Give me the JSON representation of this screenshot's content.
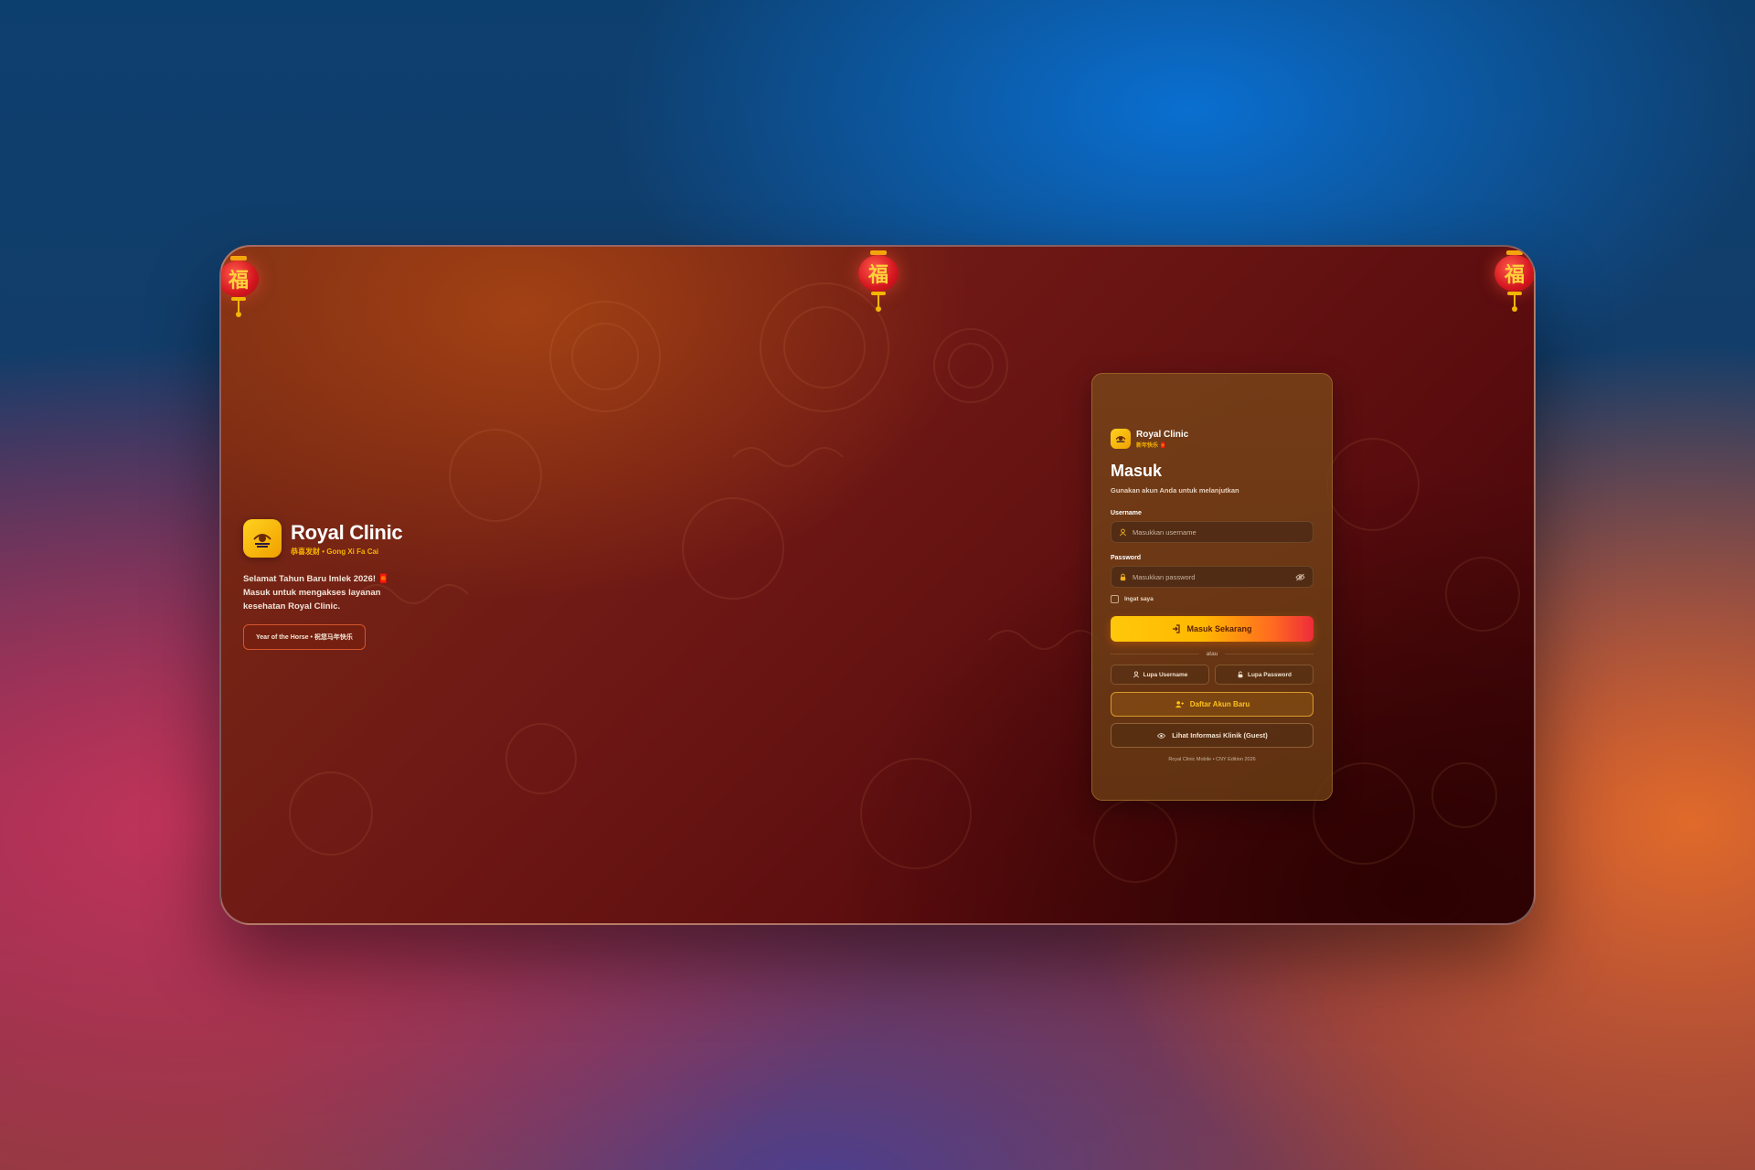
{
  "lanterns": {
    "glyph": "福"
  },
  "brand": {
    "title": "Royal Clinic",
    "subtitle": "恭喜发财 • Gong Xi Fa Cai",
    "greeting": "Selamat Tahun Baru Imlek 2026! 🧧 Masuk untuk mengakses layanan kesehatan Royal Clinic.",
    "badge": "Year of the Horse • 祝您马年快乐"
  },
  "card": {
    "brand_title": "Royal Clinic",
    "brand_sub": "新年快乐 🧧",
    "title": "Masuk",
    "subtitle": "Gunakan akun Anda untuk melanjutkan",
    "username_label": "Username",
    "username_placeholder": "Masukkan username",
    "username_value": "",
    "password_label": "Password",
    "password_placeholder": "Masukkan password",
    "password_value": "",
    "remember_label": "Ingat saya",
    "remember_checked": false,
    "submit_label": "Masuk Sekarang",
    "divider_label": "atau",
    "forgot_username_label": "Lupa Username",
    "forgot_password_label": "Lupa Password",
    "register_label": "Daftar Akun Baru",
    "guest_label": "Lihat Informasi Klinik (Guest)",
    "footer": "Royal Clinic Mobile • CNY Edition 2026"
  },
  "icons": {
    "logo": "clinic-logo-icon",
    "user": "user-icon",
    "lock": "lock-icon",
    "eye_off": "eye-off-icon",
    "login": "login-icon",
    "key": "key-icon",
    "user_plus": "user-plus-icon",
    "eye": "eye-icon"
  },
  "colors": {
    "accent_gold": "#ffc21a",
    "accent_red": "#ee2b3b",
    "card_bg": "#78461a",
    "window_bg": "#6e1815"
  }
}
